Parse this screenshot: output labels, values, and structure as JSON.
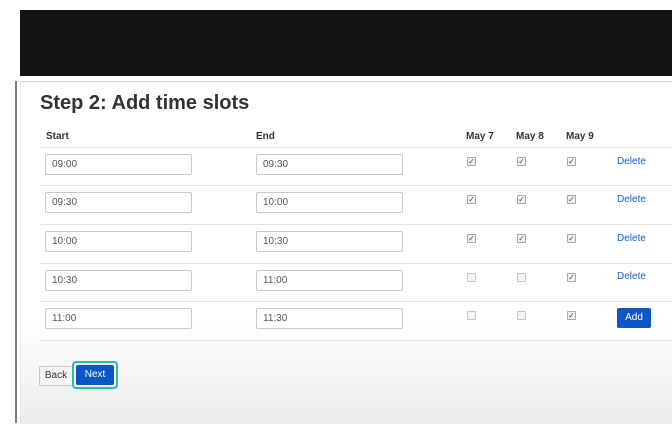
{
  "heading": "Step 2: Add time slots",
  "columns": {
    "start": "Start",
    "end": "End",
    "days": [
      "May 7",
      "May 8",
      "May 9"
    ]
  },
  "rows": [
    {
      "start": "09:00",
      "end": "09:30",
      "checks": [
        true,
        true,
        true
      ],
      "action": "Delete"
    },
    {
      "start": "09:30",
      "end": "10:00",
      "checks": [
        true,
        true,
        true
      ],
      "action": "Delete"
    },
    {
      "start": "10:00",
      "end": "10:30",
      "checks": [
        true,
        true,
        true
      ],
      "action": "Delete"
    },
    {
      "start": "10:30",
      "end": "11:00",
      "checks": [
        false,
        false,
        true
      ],
      "action": "Delete"
    },
    {
      "start": "11:00",
      "end": "11:30",
      "checks": [
        false,
        false,
        true
      ],
      "action": "Add"
    }
  ],
  "buttons": {
    "back": "Back",
    "next": "Next"
  },
  "colors": {
    "header_bar": "#141414",
    "primary_button": "#0c56c8",
    "link": "#1a5fc5",
    "focus_ring": "#23c3a0"
  }
}
